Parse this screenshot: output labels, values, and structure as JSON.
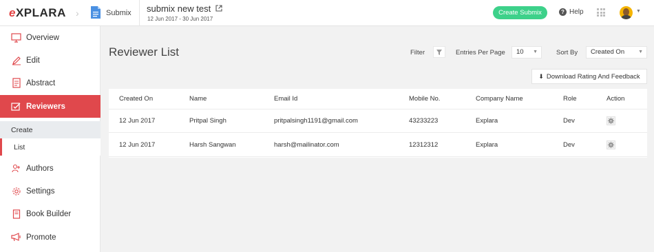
{
  "app": {
    "logo": "EXPLARA",
    "breadcrumb_label": "Submix",
    "event_title": "submix new test",
    "event_dates": "12 Jun 2017 - 30 Jun 2017",
    "create_button": "Create Submix",
    "help_label": "Help",
    "accent_color": "#e0484c",
    "create_color": "#3dd18a"
  },
  "sidebar": {
    "items": [
      {
        "label": "Overview",
        "icon": "monitor-icon"
      },
      {
        "label": "Edit",
        "icon": "pencil-icon"
      },
      {
        "label": "Abstract",
        "icon": "document-icon"
      },
      {
        "label": "Reviewers",
        "icon": "user-check-icon",
        "active": true
      },
      {
        "label": "Authors",
        "icon": "users-icon"
      },
      {
        "label": "Settings",
        "icon": "gear-icon"
      },
      {
        "label": "Book Builder",
        "icon": "book-icon"
      },
      {
        "label": "Promote",
        "icon": "megaphone-icon"
      }
    ],
    "subitems": [
      {
        "label": "Create"
      },
      {
        "label": "List",
        "current": true
      }
    ]
  },
  "main": {
    "title": "Reviewer List",
    "filter_label": "Filter",
    "entries_label": "Entries Per Page",
    "entries_value": "10",
    "sort_label": "Sort By",
    "sort_value": "Created On",
    "download_button": "Download Rating And Feedback",
    "table": {
      "headers": [
        "Created On",
        "Name",
        "Email Id",
        "Mobile No.",
        "Company Name",
        "Role",
        "Action"
      ],
      "rows": [
        [
          "12 Jun 2017",
          "Pritpal Singh",
          "pritpalsingh1191@gmail.com",
          "43233223",
          "Explara",
          "Dev"
        ],
        [
          "12 Jun 2017",
          "Harsh Sangwan",
          "harsh@mailinator.com",
          "12312312",
          "Explara",
          "Dev"
        ]
      ]
    }
  }
}
